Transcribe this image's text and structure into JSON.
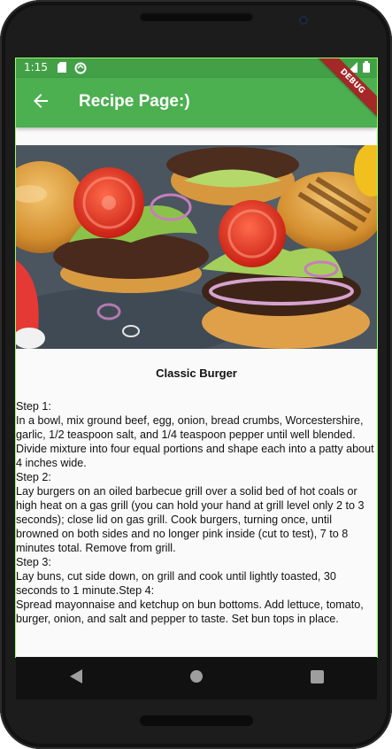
{
  "status_bar": {
    "time": "1:15",
    "icons": [
      "sd-card-icon",
      "sync-icon",
      "wifi-icon",
      "signal-icon",
      "battery-icon"
    ]
  },
  "app_bar": {
    "title": "Recipe Page:)",
    "back_icon": "arrow-left-icon",
    "debug_banner": "DEBUG",
    "color": "#4caf50"
  },
  "recipe": {
    "image_icon": "burger-photo",
    "title": "Classic Burger",
    "body": "Step 1:\nIn a bowl, mix ground beef, egg, onion, bread crumbs, Worcestershire, garlic, 1/2 teaspoon salt, and 1/4 teaspoon pepper until well blended. Divide mixture into four equal portions and shape each into a patty about 4 inches wide.\nStep 2:\nLay burgers on an oiled barbecue grill over a solid bed of hot coals or high heat on a gas grill (you can hold your hand at grill level only 2 to 3 seconds); close lid on gas grill. Cook burgers, turning once, until browned on both sides and no longer pink inside (cut to test), 7 to 8 minutes total. Remove from grill.\nStep 3:\nLay buns, cut side down, on grill and cook until lightly toasted, 30 seconds to 1 minute.Step 4:\nSpread mayonnaise and ketchup on bun bottoms. Add lettuce, tomato, burger, onion, and salt and pepper to taste. Set bun tops in place."
  },
  "nav_bar": {
    "buttons": [
      "back-triangle-icon",
      "home-circle-icon",
      "recents-square-icon"
    ]
  }
}
